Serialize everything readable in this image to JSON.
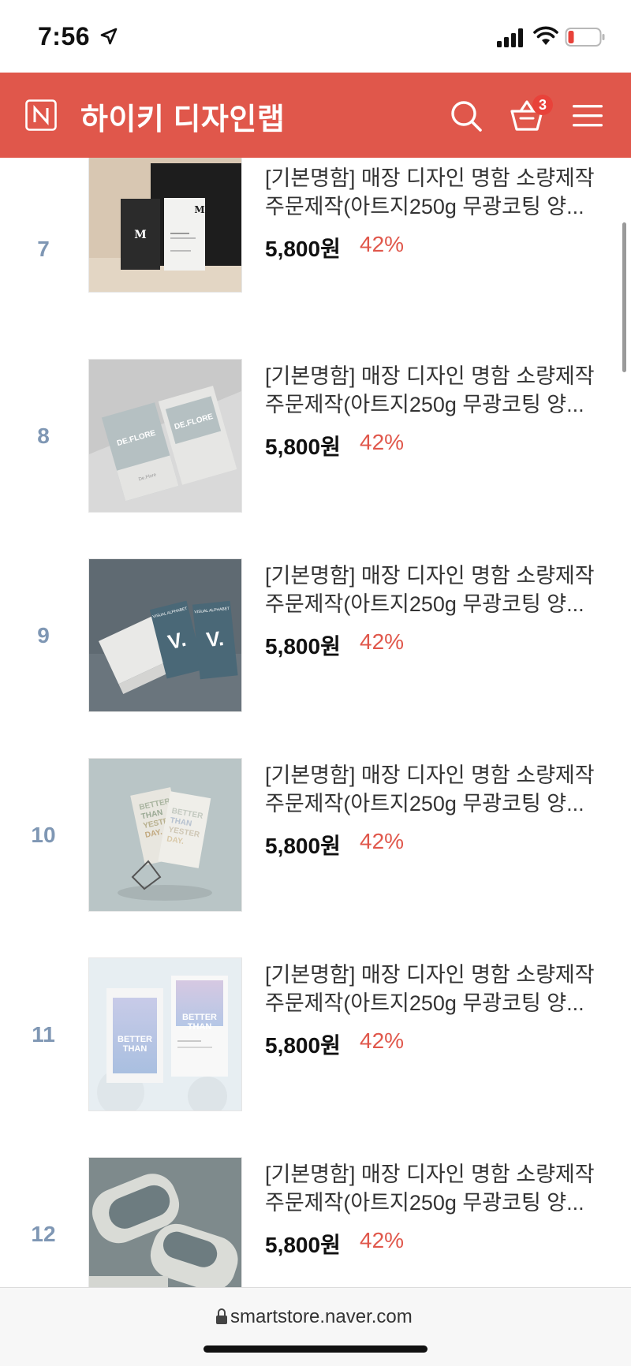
{
  "status_bar": {
    "time": "7:56",
    "icons": [
      "location-arrow-icon",
      "signal-icon",
      "wifi-icon",
      "battery-icon"
    ]
  },
  "header": {
    "logo_letter": "N",
    "store_name": "하이키 디자인랩",
    "cart_count": "3",
    "icons": [
      "search-icon",
      "cart-icon",
      "menu-icon"
    ],
    "background_color": "#e0574b"
  },
  "products": [
    {
      "rank": "7",
      "name_line1": "[기본명함] 매장 디자인 명함 소량제작",
      "name_line2": "주문제작(아트지250g 무광코팅 양...",
      "price": "5,800원",
      "discount": "42%"
    },
    {
      "rank": "8",
      "name_line1": "[기본명함] 매장 디자인 명함 소량제작",
      "name_line2": "주문제작(아트지250g 무광코팅 양...",
      "price": "5,800원",
      "discount": "42%"
    },
    {
      "rank": "9",
      "name_line1": "[기본명함] 매장 디자인 명함 소량제작",
      "name_line2": "주문제작(아트지250g 무광코팅 양...",
      "price": "5,800원",
      "discount": "42%"
    },
    {
      "rank": "10",
      "name_line1": "[기본명함] 매장 디자인 명함 소량제작",
      "name_line2": "주문제작(아트지250g 무광코팅 양...",
      "price": "5,800원",
      "discount": "42%"
    },
    {
      "rank": "11",
      "name_line1": "[기본명함] 매장 디자인 명함 소량제작",
      "name_line2": "주문제작(아트지250g 무광코팅 양...",
      "price": "5,800원",
      "discount": "42%"
    },
    {
      "rank": "12",
      "name_line1": "[기본명함] 매장 디자인 명함 소량제작",
      "name_line2": "주문제작(아트지250g 무광코팅 양...",
      "price": "5,800원",
      "discount": "42%"
    }
  ],
  "thumbnails": {
    "t7": {
      "mark": "M"
    },
    "t8": {
      "brand": "DE.FLORE",
      "small": "De.Flore"
    },
    "t9": {
      "brand": "VISUAL ALPHABET",
      "mark": "V."
    },
    "t10": {
      "lines": [
        "BETTER",
        "THAN",
        "YESTER",
        "DAY."
      ]
    },
    "t11": {
      "lines": [
        "BETTER",
        "THAN"
      ]
    }
  },
  "url_bar": {
    "url": "smartstore.naver.com"
  },
  "colors": {
    "accent": "#e0574b",
    "rank_color": "#7f97b4",
    "discount_color": "#e0574b"
  }
}
